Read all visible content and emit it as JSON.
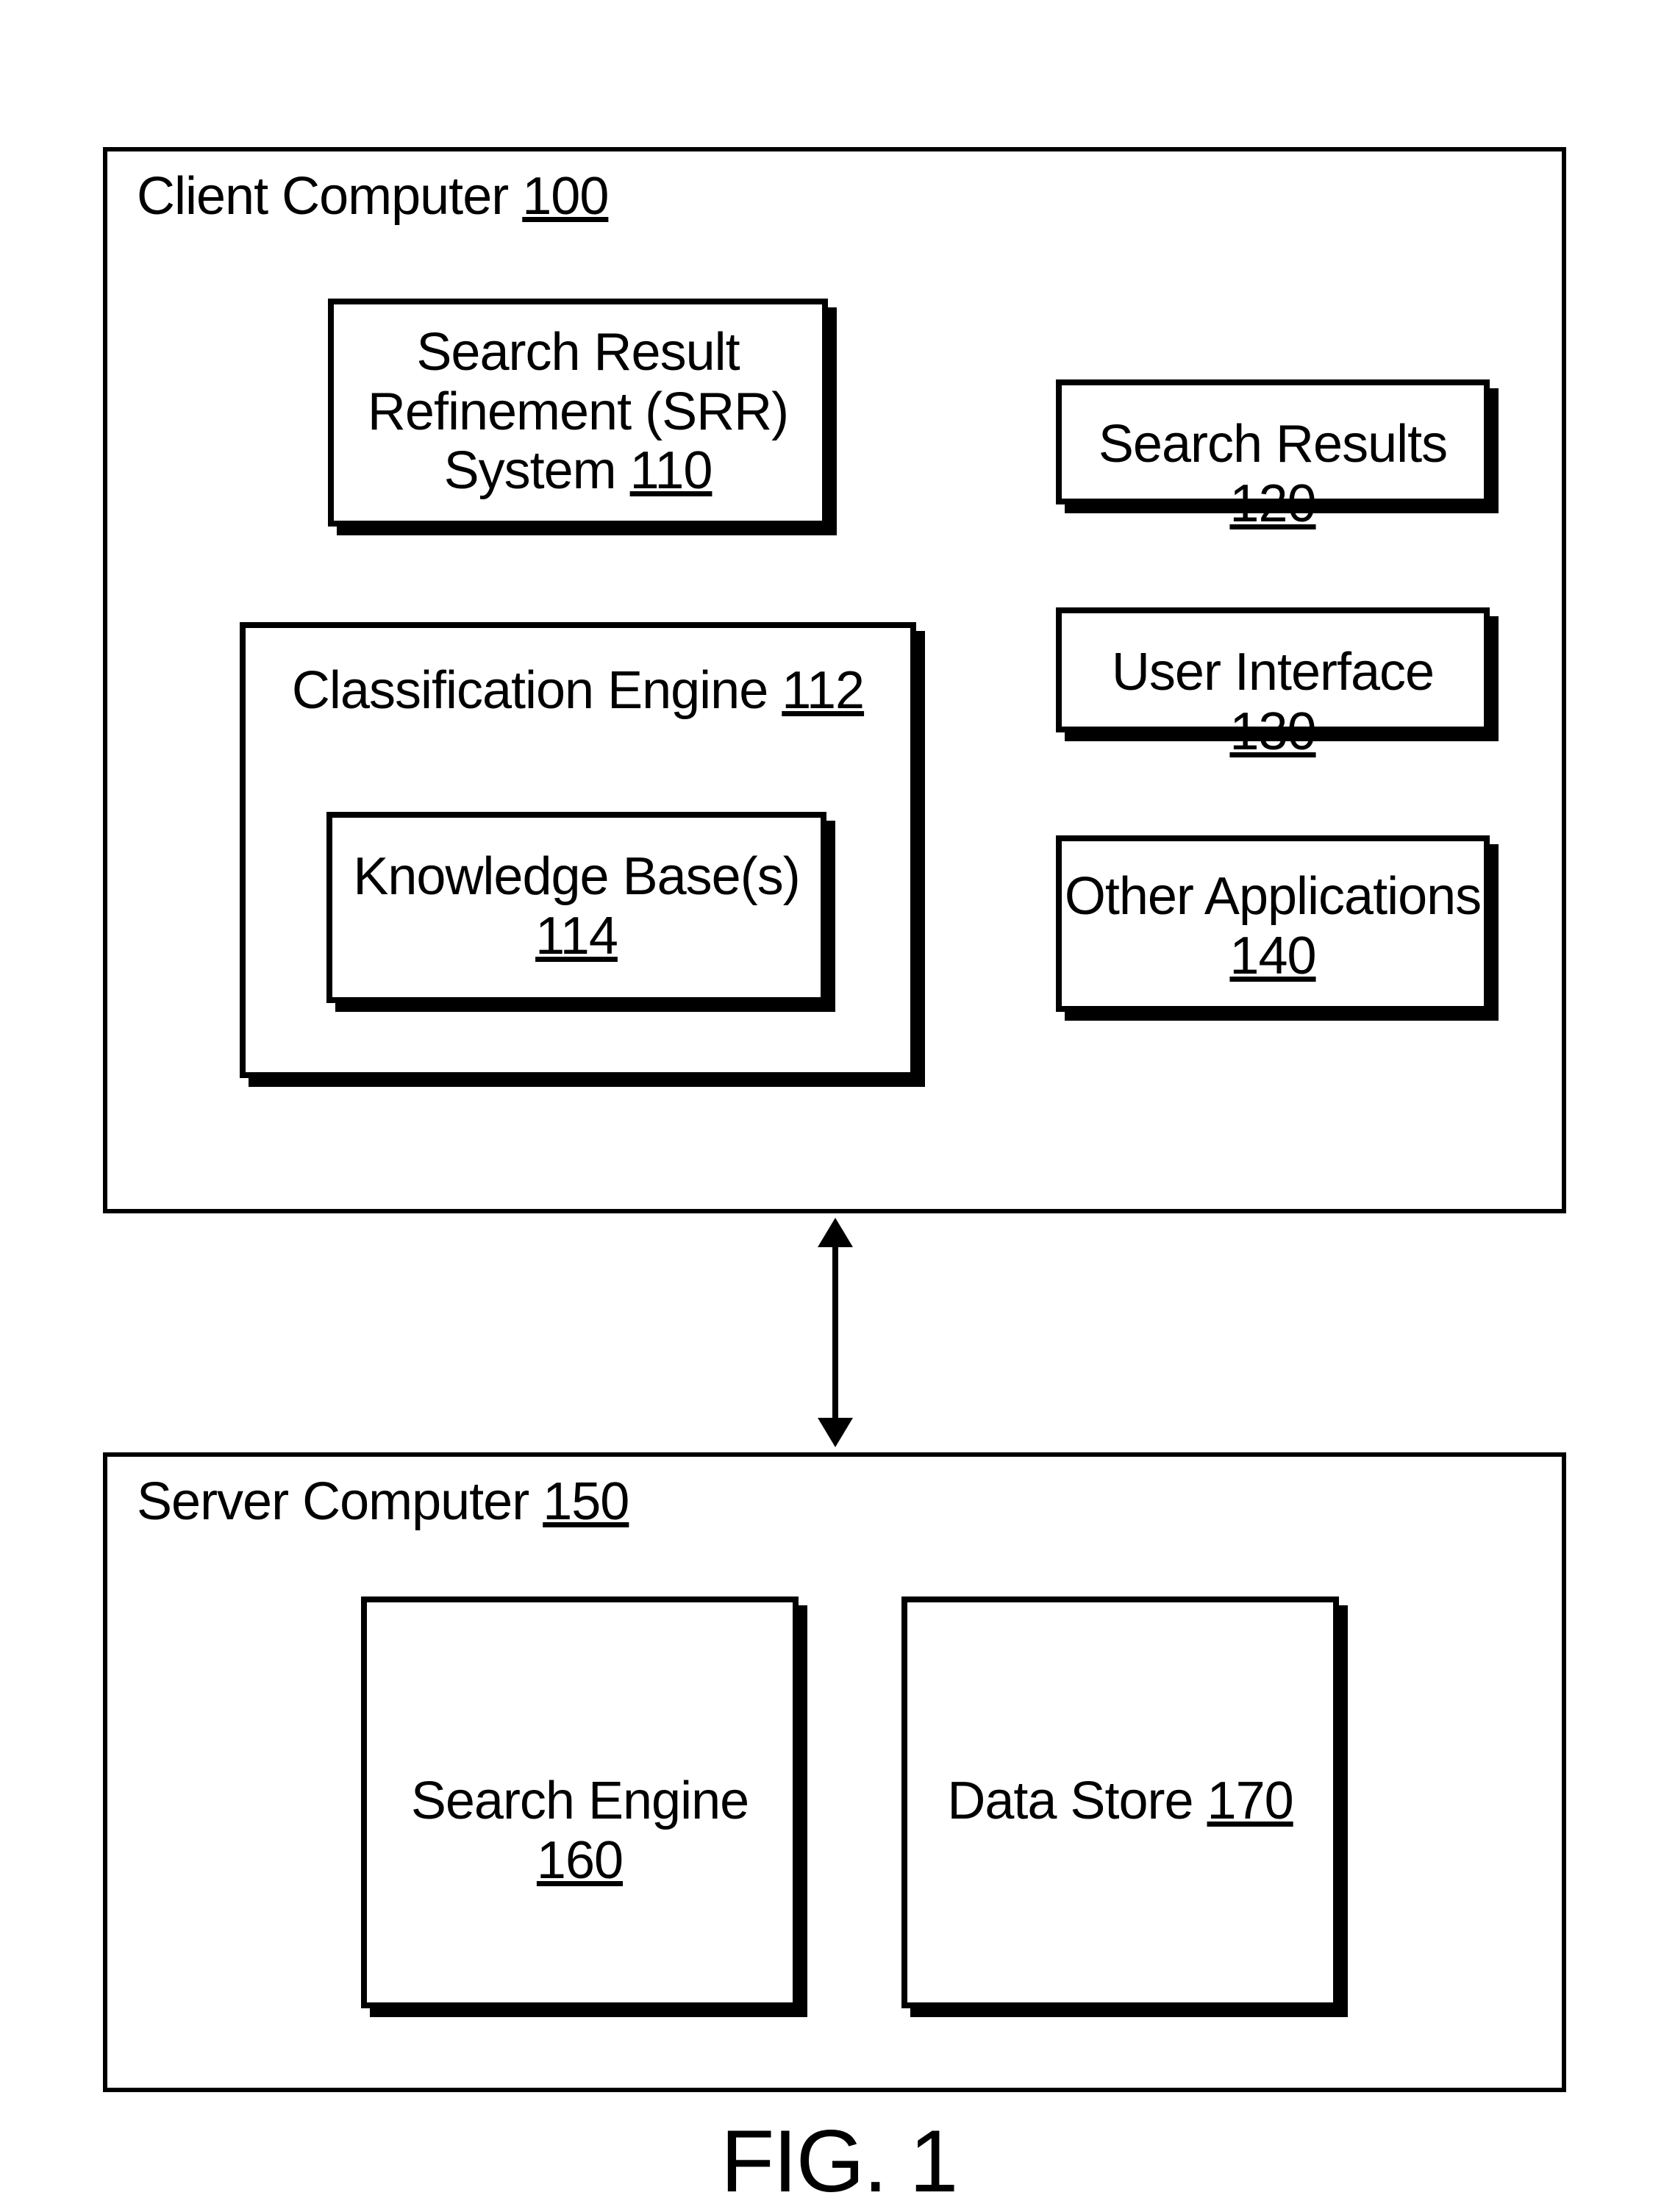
{
  "client": {
    "title_text": "Client Computer",
    "title_num": "100",
    "srr": {
      "line1": "Search Result",
      "line2": "Refinement (SRR)",
      "line3_text": "System",
      "line3_num": "110"
    },
    "clseng": {
      "title_text": "Classification Engine",
      "title_num": "112",
      "kb": {
        "line1": "Knowledge Base(s)",
        "num": "114"
      }
    },
    "search_results": {
      "text": "Search Results",
      "num": "120"
    },
    "ui": {
      "text": "User Interface",
      "num": "130"
    },
    "other_apps": {
      "line1": "Other Applications",
      "num": "140"
    }
  },
  "server": {
    "title_text": "Server Computer",
    "title_num": "150",
    "engine": {
      "text": "Search Engine",
      "num": "160"
    },
    "store": {
      "text": "Data Store",
      "num": "170"
    }
  },
  "figure_caption": "FIG. 1"
}
